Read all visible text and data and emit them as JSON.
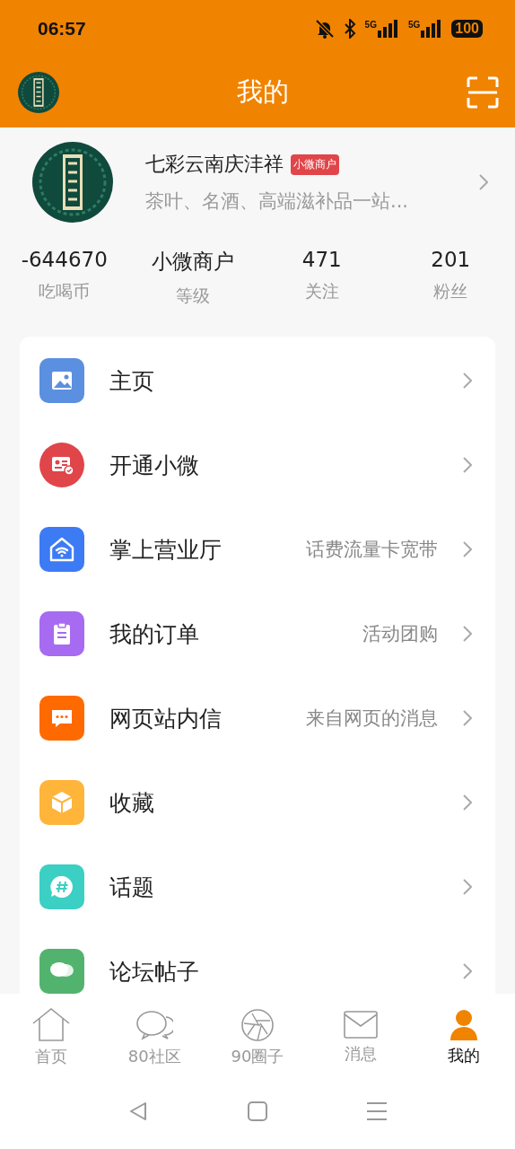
{
  "status_bar": {
    "time": "06:57",
    "battery": "100",
    "network_1": "5G",
    "network_2": "5G"
  },
  "header": {
    "title": "我的"
  },
  "profile": {
    "name": "七彩云南庆沣祥",
    "badge": "小微商户",
    "description": "茶叶、名酒、高端滋补品一站..."
  },
  "stats": [
    {
      "value": "-644670",
      "label": "吃喝币"
    },
    {
      "value": "小微商户",
      "label": "等级"
    },
    {
      "value": "471",
      "label": "关注"
    },
    {
      "value": "201",
      "label": "粉丝"
    }
  ],
  "menu": [
    {
      "label": "主页",
      "color": "#5b8fe0"
    },
    {
      "label": "开通小微",
      "color": "#e0454a"
    },
    {
      "label": "掌上营业厅",
      "detail": "话费流量卡宽带",
      "color": "#3d7bf5"
    },
    {
      "label": "我的订单",
      "detail": "活动团购",
      "color": "#a66bf0"
    },
    {
      "label": "网页站内信",
      "detail": "来自网页的消息",
      "color": "#ff6a00"
    },
    {
      "label": "收藏",
      "color": "#ffb43a"
    },
    {
      "label": "话题",
      "color": "#3ccfc4"
    },
    {
      "label": "论坛帖子",
      "color": "#52b36e"
    }
  ],
  "tab_bar": [
    {
      "label": "首页",
      "selected": false
    },
    {
      "label": "80社区",
      "selected": false
    },
    {
      "label": "90圈子",
      "selected": false
    },
    {
      "label": "消息",
      "selected": false
    },
    {
      "label": "我的",
      "selected": true
    }
  ]
}
